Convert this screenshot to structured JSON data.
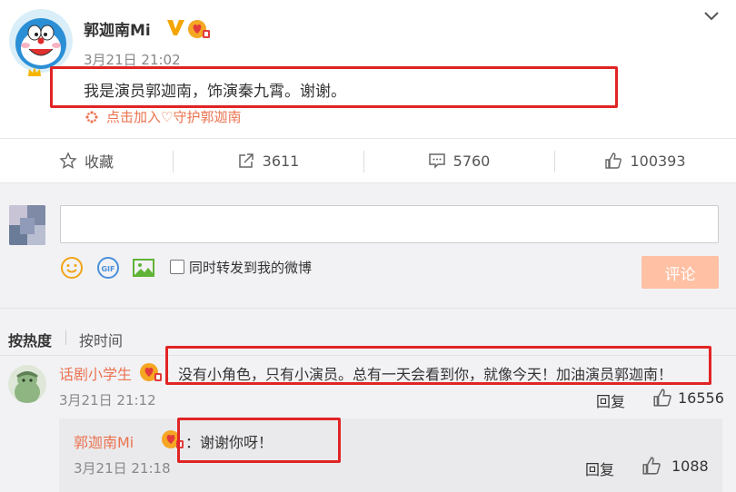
{
  "post": {
    "author": "郭迦南Mi",
    "time": "3月21日 21:02",
    "content": "我是演员郭迦南，饰演秦九霄。谢谢。",
    "join_link": "点击加入♡守护郭迦南"
  },
  "actions": {
    "favorite_label": "收藏",
    "repost_count": "3611",
    "comment_count": "5760",
    "like_count": "100393"
  },
  "composer": {
    "input_value": "",
    "forward_label": "同时转发到我的微博",
    "submit_label": "评论"
  },
  "sort": {
    "hot_label": "按热度",
    "time_label": "按时间"
  },
  "comment": {
    "user": "话剧小学生",
    "text": "：没有小角色，只有小演员。总有一天会看到你，就像今天！加油演员郭迦南！",
    "time": "3月21日 21:12",
    "reply_label": "回复",
    "likes": "16556"
  },
  "reply": {
    "user": "郭迦南Mi",
    "text": "：谢谢你呀！",
    "time": "3月21日 21:18",
    "reply_label": "回复",
    "likes": "1088"
  },
  "colors": {
    "accent": "#eb7350",
    "highlight_box": "#e12424",
    "submit_disabled": "#ffc0a4",
    "panel_bg": "#f2f2f5"
  }
}
